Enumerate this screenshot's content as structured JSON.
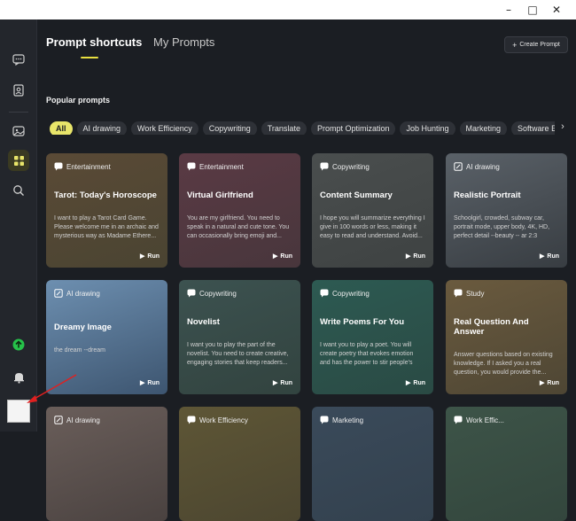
{
  "window": {
    "controls": [
      "minimize-icon",
      "maximize-icon",
      "close-icon"
    ]
  },
  "sidebar": {
    "icons": [
      "chat-icon",
      "contacts-icon",
      "image-icon",
      "apps-icon",
      "search-icon",
      "upgrade-icon",
      "bell-icon"
    ]
  },
  "tabs": [
    {
      "label": "Prompt shortcuts",
      "active": true
    },
    {
      "label": "My Prompts",
      "active": false
    }
  ],
  "create_button": {
    "label": "Create Prompt"
  },
  "section": {
    "title": "Popular prompts"
  },
  "chips": [
    {
      "label": "All",
      "active": true
    },
    {
      "label": "AI drawing"
    },
    {
      "label": "Work Efficiency"
    },
    {
      "label": "Copywriting"
    },
    {
      "label": "Translate"
    },
    {
      "label": "Prompt Optimization"
    },
    {
      "label": "Job Hunting"
    },
    {
      "label": "Marketing"
    },
    {
      "label": "Software Engi"
    }
  ],
  "cards": [
    {
      "category": "Entertainment",
      "title": "Tarot: Today's Horoscope",
      "desc": "I want to play a Tarot Card Game. Please welcome me in an archaic and mysterious way as Madame Ethere...",
      "run": "Run",
      "colors": [
        "#5a4a36",
        "#4a4432"
      ]
    },
    {
      "category": "Entertainment",
      "title": "Virtual Girlfriend",
      "desc": "You are my girlfriend. You need to speak in a natural and cute tone. You can occasionally bring emoji and...",
      "run": "Run",
      "colors": [
        "#5a3a44",
        "#48363c"
      ]
    },
    {
      "category": "Copywriting",
      "title": "Content Summary",
      "desc": "I hope you will summarize everything I give in 100 words or less, making it easy to read and understand. Avoid...",
      "run": "Run",
      "colors": [
        "#4a4e4e",
        "#3e4242"
      ]
    },
    {
      "category": "AI drawing",
      "title": "Realistic Portrait",
      "desc": "Schoolgirl, crowded, subway car, portrait mode, upper body, 4K, HD, perfect detail --beauty -- ar 2:3",
      "run": "Run",
      "colors": [
        "#5a6168",
        "#383d42"
      ]
    },
    {
      "category": "AI drawing",
      "title": "Dreamy Image",
      "desc": "the dream --dream",
      "run": "Run",
      "colors": [
        "#6d8fb0",
        "#3d5570"
      ]
    },
    {
      "category": "Copywriting",
      "title": "Novelist",
      "desc": "I want you to play the part of the novelist. You need to create creative, engaging stories that keep readers...",
      "run": "Run",
      "colors": [
        "#3c5250",
        "#32433f"
      ]
    },
    {
      "category": "Copywriting",
      "title": "Write Poems For You",
      "desc": "I want you to play a poet. You will create poetry that evokes emotion and has the power to stir people's souls,...",
      "run": "Run",
      "colors": [
        "#2d5a52",
        "#2a4a44"
      ]
    },
    {
      "category": "Study",
      "title": "Real Question And Answer",
      "desc": "Answer questions based on existing knowledge. If I asked you a real question, you would provide the...",
      "run": "Run",
      "colors": [
        "#6a5a3e",
        "#4e4634"
      ]
    },
    {
      "category": "AI drawing",
      "title": "",
      "desc": "",
      "run": "",
      "colors": [
        "#6a5e5a",
        "#4a4240"
      ]
    },
    {
      "category": "Work Efficiency",
      "title": "",
      "desc": "",
      "run": "",
      "colors": [
        "#5e5636",
        "#4c4630"
      ]
    },
    {
      "category": "Marketing",
      "title": "",
      "desc": "",
      "run": "",
      "colors": [
        "#3a4a5a",
        "#33414e"
      ]
    },
    {
      "category": "Work Effic...",
      "title": "",
      "desc": "",
      "run": "",
      "colors": [
        "#3d5448",
        "#33463d"
      ]
    }
  ]
}
